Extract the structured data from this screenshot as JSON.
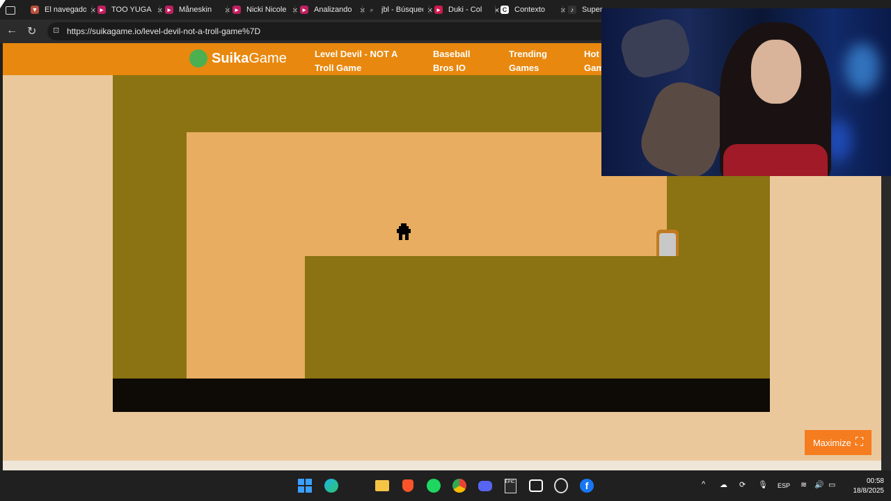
{
  "browser": {
    "tabs": [
      {
        "title": "El navegador",
        "color": "#b8503c"
      },
      {
        "title": "TOO YUGA",
        "color": "#c02060"
      },
      {
        "title": "Måneskin",
        "color": "#c02060"
      },
      {
        "title": "Nicki Nicole",
        "color": "#c02060"
      },
      {
        "title": "Analizando",
        "color": "#c02060"
      },
      {
        "title": "jbl - Búsqueda",
        "color": "#888888"
      },
      {
        "title": "Duki - Col",
        "color": "#d01a50"
      },
      {
        "title": "Contexto",
        "color": "#ffffff"
      },
      {
        "title": "Super",
        "color": "#333333"
      }
    ],
    "url": "https://suikagame.io/level-devil-not-a-troll-game%7D"
  },
  "site": {
    "logo_bold": "Suika",
    "logo_light": "Game",
    "nav": [
      {
        "line1": "Level Devil - NOT A",
        "line2": "Troll Game"
      },
      {
        "line1": "Baseball",
        "line2": "Bros IO"
      },
      {
        "line1": "Trending",
        "line2": "Games"
      },
      {
        "line1": "Hot",
        "line2": "Gam"
      }
    ],
    "maximize_label": "Maximize"
  },
  "colors": {
    "header": "#e8880e",
    "page_bg": "#ebc89c",
    "game_wall": "#8b7213",
    "game_floor_path": "#e8ad60",
    "game_base": "#0e0a06",
    "maximize_button": "#f57c1f"
  },
  "taskbar": {
    "icons": [
      "start-icon",
      "edge-icon",
      "file-explorer-icon",
      "brave-icon",
      "spotify-icon",
      "chrome-icon",
      "discord-icon",
      "epic-games-icon",
      "app-icon",
      "steam-icon",
      "facebook-icon"
    ],
    "lang": "ESP",
    "time": "00:58",
    "date": "18/8/2025"
  }
}
